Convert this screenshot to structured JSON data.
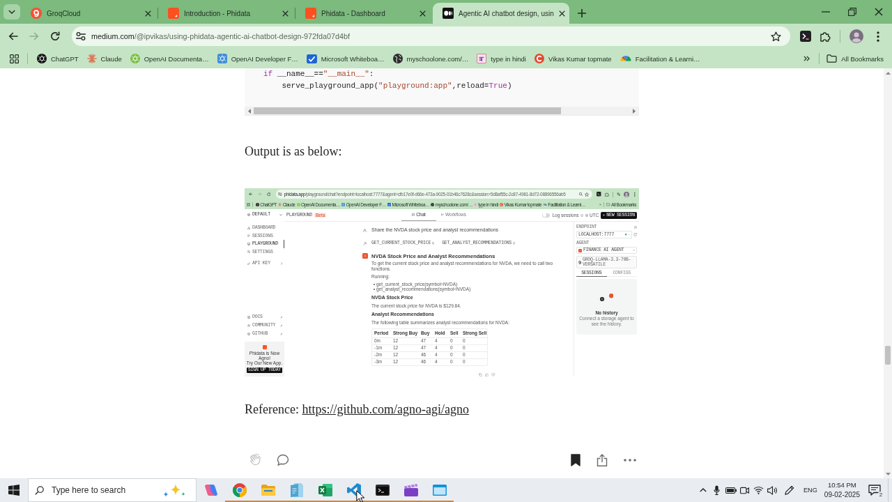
{
  "browser": {
    "tabs": [
      {
        "title": "GroqCloud",
        "kind": "groq",
        "selected": false
      },
      {
        "title": "Introduction - Phidata",
        "kind": "phidata",
        "selected": false
      },
      {
        "title": "Phidata - Dashboard",
        "kind": "phidata",
        "selected": false
      },
      {
        "title": "Agentic AI chatbot design, usin",
        "kind": "medium",
        "selected": true
      }
    ],
    "back_disabled": false,
    "forward_disabled": true,
    "address": {
      "host": "medium.com",
      "path": "/@ipvikas/using-phidata-agentic-ai-chatbot-design-972fda07d4bf"
    },
    "bookmarks": [
      {
        "label": "ChatGPT",
        "kind": "chatgpt"
      },
      {
        "label": "Claude",
        "kind": "claude"
      },
      {
        "label": "OpenAI Documenta…",
        "kind": "openai-docs"
      },
      {
        "label": "OpenAI Developer F…",
        "kind": "openai-dev"
      },
      {
        "label": "Microsoft Whiteboa…",
        "kind": "whiteboard"
      },
      {
        "label": "myschoolone.com/…",
        "kind": "globe"
      },
      {
        "label": "type in hindi",
        "kind": "letter"
      },
      {
        "label": "Vikas Kumar topmate",
        "kind": "topmate"
      },
      {
        "label": "Facilitation & Learni…",
        "kind": "fan"
      }
    ],
    "all_bookmarks": "All Bookmarks"
  },
  "article": {
    "code": [
      [
        {
          "text": "if",
          "kind": "keyword"
        },
        {
          "text": " __name__==",
          "kind": "plain"
        },
        {
          "text": "\"__main__\"",
          "kind": "string"
        },
        {
          "text": ":",
          "kind": "plain"
        }
      ],
      [
        {
          "text": "    serve_playground_app(",
          "kind": "plain"
        },
        {
          "text": "\"playground:app\"",
          "kind": "string"
        },
        {
          "text": ",reload=",
          "kind": "plain"
        },
        {
          "text": "True",
          "kind": "keyword"
        },
        {
          "text": ")",
          "kind": "plain"
        }
      ]
    ],
    "output_intro": "Output is as below:",
    "screenshot": {
      "back_disabled": false,
      "forward_disabled": true,
      "zoomed": true,
      "address": {
        "host": "phidata.app",
        "path": "/playground/chat?endpoint=localhost:7777&agent=cfb17e0f-d66e-473a-9025-01b46c7628c&session=5d8af55c-2c87-4961-8d72-08896556ab5"
      },
      "bookmarks": [
        {
          "label": "ChatGPT",
          "kind": "chatgpt"
        },
        {
          "label": "Claude",
          "kind": "claude"
        },
        {
          "label": "OpenAI Documenta…",
          "kind": "openai-docs"
        },
        {
          "label": "OpenAI Developer F…",
          "kind": "openai-dev"
        },
        {
          "label": "Microsoft Whiteboa…",
          "kind": "whiteboard"
        },
        {
          "label": "myschoolone.com/…",
          "kind": "globe"
        },
        {
          "label": "type in hindi",
          "kind": "letter"
        },
        {
          "label": "Vikas Kumar topmate",
          "kind": "topmate"
        },
        {
          "label": "Facilitation & Learni…",
          "kind": "fan"
        }
      ],
      "all_bookmarks": "All Bookmarks",
      "workspace": "DEFAULT",
      "nav": [
        {
          "label": "DASHBOARD",
          "kind": "dashboard",
          "selected": false
        },
        {
          "label": "SESSIONS",
          "kind": "sessions",
          "selected": false
        },
        {
          "label": "PLAYGROUND",
          "kind": "playground",
          "selected": true
        },
        {
          "label": "SETTINGS",
          "kind": "settings",
          "selected": false
        },
        {
          "label": "API KEY",
          "kind": "key",
          "selected": false
        }
      ],
      "links": [
        {
          "label": "DOCS",
          "kind": "docs"
        },
        {
          "label": "COMMUNITY",
          "kind": "community"
        },
        {
          "label": "GITHUB",
          "kind": "github"
        }
      ],
      "promo": {
        "title": "Phidata is Now Agno!",
        "subtitle": "Try Our New App.",
        "button": "SIGN UP TODAY"
      },
      "title": "PLAYGROUND",
      "badge": "Beta",
      "tabs": [
        {
          "label": "Chat",
          "kind": "chat",
          "selected": true
        },
        {
          "label": "Workflows",
          "kind": "workflows",
          "selected": false
        }
      ],
      "log_sessions": {
        "label": "Log sessions",
        "on": false
      },
      "timezone": "UTC",
      "new_session": "NEW SESSION",
      "chat": {
        "prompt": "Share the NVDA stock price and analyst recommendations",
        "tools": [
          "GET_CURRENT_STOCK_PRICE",
          "GET_ANALYST_RECOMMENDATIONS"
        ],
        "heading": "NVDA Stock Price and Analyst Recommendations",
        "intro": "To get the current stock price and analyst recommendations for NVDA, we need to call two functions.",
        "running_label": "Running:",
        "calls": [
          "get_current_stock_price(symbol=NVDA)",
          "get_analyst_recommendations(symbol=NVDA)"
        ],
        "price_heading": "NVDA Stock Price",
        "price_text": "The current stock price for NVDA is $129.84.",
        "recs_heading": "Analyst Recommendations",
        "recs_text": "The following table summarizes analyst recommendations for NVDA:",
        "table": {
          "columns": [
            "Period",
            "Strong Buy",
            "Buy",
            "Hold",
            "Sell",
            "Strong Sell"
          ],
          "rows": [
            [
              "0m",
              "12",
              "47",
              "4",
              "0",
              "0"
            ],
            [
              "-1m",
              "12",
              "47",
              "4",
              "0",
              "0"
            ],
            [
              "-2m",
              "12",
              "46",
              "4",
              "0",
              "0"
            ],
            [
              "-3m",
              "12",
              "46",
              "4",
              "0",
              "0"
            ]
          ]
        }
      },
      "panel": {
        "endpoint_label": "ENDPOINT",
        "endpoint": "LOCALHOST:7777",
        "endpoint_online": true,
        "agent_label": "AGENT",
        "agent": "FINANCE AI AGENT",
        "model": "GROQ-LLAMA-3.3-70B-VERSATILE",
        "tabs": [
          {
            "label": "SESSIONS",
            "selected": true
          },
          {
            "label": "CONFIGS",
            "selected": false
          }
        ],
        "empty_title": "No history",
        "empty_text": "Connect a storage agent to see the history."
      }
    },
    "reference": {
      "label": "Reference:",
      "link": "https://github.com/agno-agi/agno"
    },
    "bookmarked": true
  },
  "taskbar": {
    "search_placeholder": "Type here to search",
    "apps": [
      {
        "kind": "copilot",
        "running": false
      },
      {
        "kind": "chrome",
        "running": true
      },
      {
        "kind": "explorer",
        "running": true
      },
      {
        "kind": "notepad",
        "running": true
      },
      {
        "kind": "excel",
        "running": true
      },
      {
        "kind": "vscode",
        "running": true
      },
      {
        "kind": "terminal",
        "running": true
      },
      {
        "kind": "clapper",
        "running": true
      },
      {
        "kind": "window",
        "running": true
      }
    ],
    "language": "ENG",
    "time": "10:54 PM",
    "date": "09-02-2025",
    "notifications": "2"
  }
}
